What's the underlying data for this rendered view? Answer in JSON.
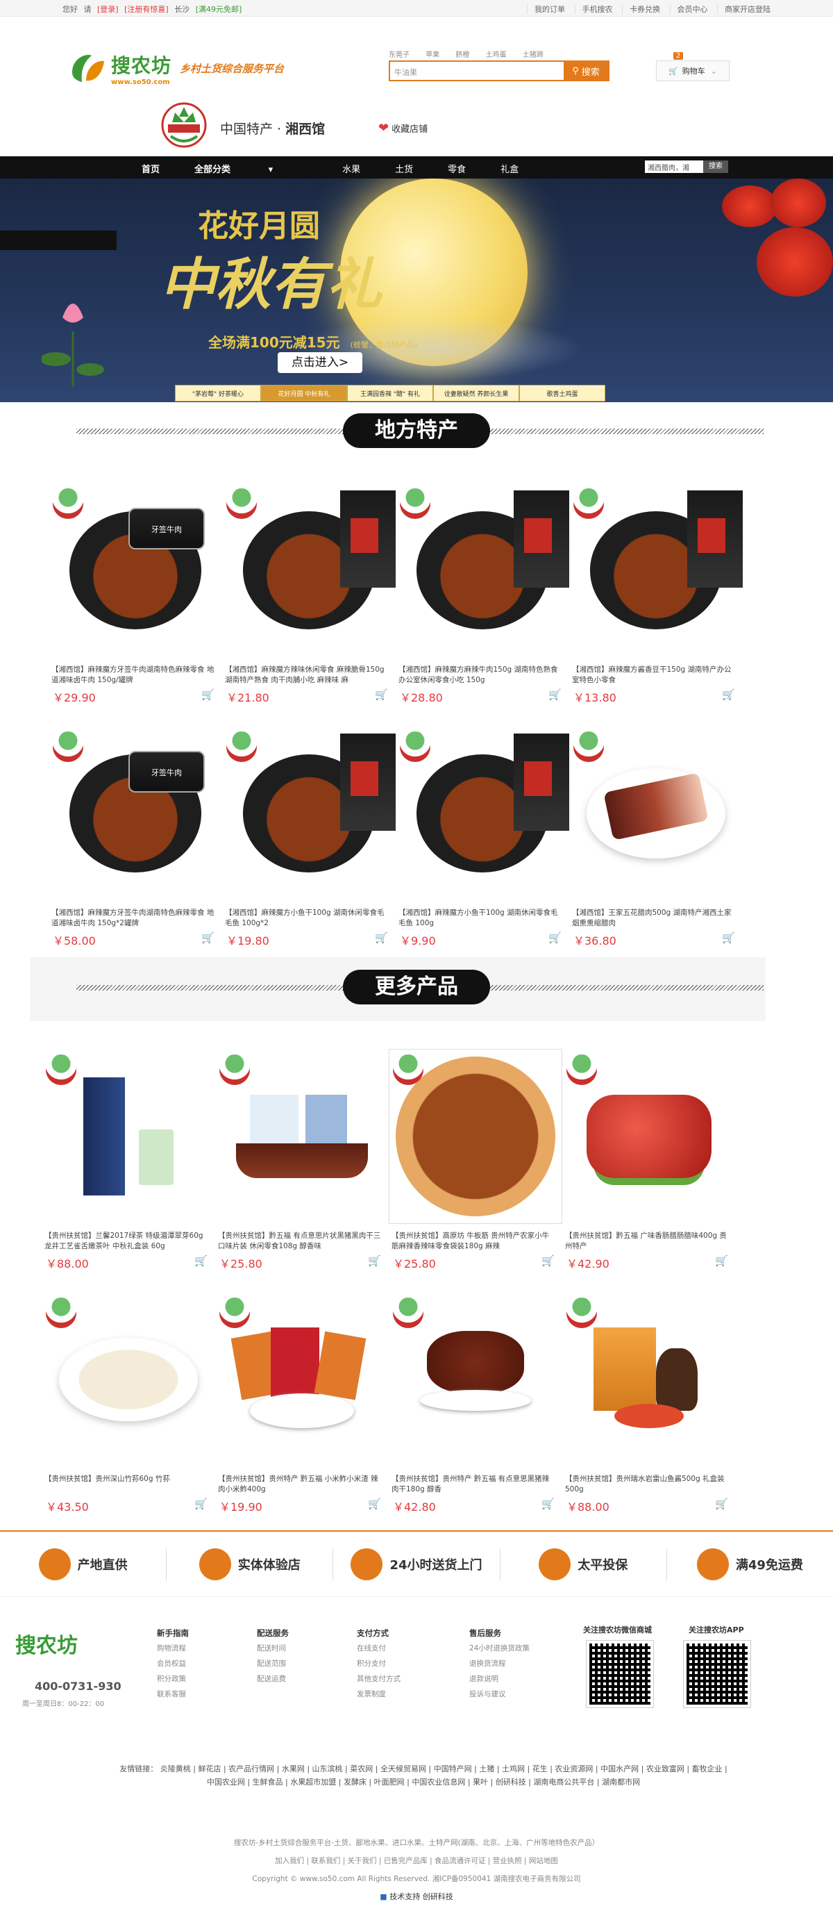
{
  "topbar": {
    "greeting": "您好",
    "login": "请",
    "login_link": "[登录]",
    "register": "[注册有惊喜]",
    "city": "长沙",
    "free_ship": "[满49元免邮]",
    "right_links": [
      "我的订单",
      "手机搜农",
      "卡券兑换",
      "会员中心",
      "商家开店登陆"
    ]
  },
  "header": {
    "logo_cn": "搜农坊",
    "logo_en": "www.so50.com",
    "slogan": "乡村土货综合服务平台",
    "hot_words": [
      "东莞子",
      "苹果",
      "脐橙",
      "土鸡蛋",
      "土猪蹄"
    ],
    "search_placeholder": "牛油果",
    "search_button": "搜索",
    "cart_label": "购物车",
    "cart_count": "2"
  },
  "shop": {
    "name_prefix": "中国特产 ·",
    "name": "湘西馆",
    "favorite": "收藏店铺"
  },
  "nav": {
    "items": [
      "首页",
      "全部分类",
      "水果",
      "土货",
      "零食",
      "礼盒"
    ],
    "search_value": "湘西腊肉，湘",
    "search_button": "搜索"
  },
  "banner": {
    "title1": "花好月圆",
    "title2": "中秋有礼",
    "promo": "全场满100元减15元",
    "promo_note": "(螃蟹、数月特产品)",
    "enter_button": "点击进入>",
    "tabs": [
      "\"茅岩莓\" 好茶暖心",
      "花好月圆 中秋有礼",
      "王满园香辣 \"醋\" 有礼",
      "诠妻散疑然 养颜长生果",
      "歌善土鸡蛋"
    ]
  },
  "sections": {
    "local": "地方特产",
    "more": "更多产品"
  },
  "local_products": [
    {
      "desc": "【湘西馆】麻辣魔方牙签牛肉湖南特色麻辣零食 地道湘味卤牛肉 150g/罐牌",
      "price": "￥29.90"
    },
    {
      "desc": "【湘西馆】麻辣魔方辣味休闲零食 麻辣脆骨150g 湖南特产熟食 肉干肉脯小吃 麻辣味 麻",
      "price": "￥21.80"
    },
    {
      "desc": "【湘西馆】麻辣魔方麻辣牛肉150g 湖南特色熟食 办公室休闲零食小吃 150g",
      "price": "￥28.80"
    },
    {
      "desc": "【湘西馆】麻辣魔方酱香豆干150g 湖南特产办公室特色小零食",
      "price": "￥13.80"
    },
    {
      "desc": "【湘西馆】麻辣魔方牙签牛肉湖南特色麻辣零食 地道湘味卤牛肉 150g*2罐牌",
      "price": "￥58.00"
    },
    {
      "desc": "【湘西馆】麻辣魔方小鱼干100g 湖南休闲零食毛毛鱼 100g*2",
      "price": "￥19.80"
    },
    {
      "desc": "【湘西馆】麻辣魔方小鱼干100g 湖南休闲零食毛毛鱼 100g",
      "price": "￥9.90"
    },
    {
      "desc": "【湘西馆】王家五花腊肉500g 湖南特产湘西土家烟熏熏缩腊肉",
      "price": "￥36.80"
    }
  ],
  "more_products": [
    {
      "desc": "【贵州扶贫馆】兰馨2017绿茶 特级湄潭翠芽60g 龙井工艺雀舌嫩茶叶 中秋礼盒装 60g",
      "price": "￥88.00"
    },
    {
      "desc": "【贵州扶贫馆】黔五福 有点意思片状黑猪黑肉干三口味片装 休闲零食108g 醇香味",
      "price": "￥25.80"
    },
    {
      "desc": "【贵州扶贫馆】高原坊 牛板筋 贵州特产农家小牛筋麻辣香辣味零食袋装180g 麻辣",
      "price": "￥25.80"
    },
    {
      "desc": "【贵州扶贫馆】黔五福 广味香肠腊肠腊味400g 贵州特产",
      "price": "￥42.90"
    },
    {
      "desc": "【贵州扶贫馆】贵州深山竹荪60g 竹荪",
      "price": "￥43.50"
    },
    {
      "desc": "【贵州扶贫馆】贵州特产 黔五福 小米鲊小米渣 辣肉小米鲊400g",
      "price": "￥19.90"
    },
    {
      "desc": "【贵州扶贫馆】贵州特产 黔五福 有点意思黑猪辣肉干180g 醇香",
      "price": "￥42.80"
    },
    {
      "desc": "【贵州扶贫馆】贵州瑞水岩雷山鱼酱500g 礼盒装500g",
      "price": "￥88.00"
    }
  ],
  "features": [
    "产地直供",
    "实体体验店",
    "24小时送货上门",
    "太平投保",
    "满49免运费"
  ],
  "footer": {
    "logo": "搜农坊",
    "phone": "400-0731-930",
    "hours": "周一至周日8：00-22：00",
    "cols": [
      {
        "title": "新手指南",
        "items": [
          "购物流程",
          "会员权益",
          "积分政策",
          "联系客服"
        ]
      },
      {
        "title": "配送服务",
        "items": [
          "配送时间",
          "配送范围",
          "配送运费"
        ]
      },
      {
        "title": "支付方式",
        "items": [
          "在线支付",
          "积分支付",
          "其他支付方式",
          "发票制度"
        ]
      },
      {
        "title": "售后服务",
        "items": [
          "24小时退换货政策",
          "退换货流程",
          "退款说明",
          "投诉与建议"
        ]
      }
    ],
    "qr1_label": "关注搜农坊微信商城",
    "qr2_label": "关注搜农坊APP"
  },
  "friend_links": "友情链接： 炎陵黄桃 | 鲜花店 | 农产品行情网 | 水果网 | 山东滨桃 | 菜农网 | 全天候贸易网 | 中国特产网 | 土猪 | 土鸡网 | 花生 | 农业资源网 | 中国水产网 | 农业致富网 | 畜牧企业 | 中国农业网 | 生鲜食品 | 水果超市加盟 | 发酵床 | 叶面肥网 | 中国农业信息网 | 果叶 | 创研科技 | 湖南电商公共平台 | 湖南都市网",
  "bottom": {
    "line1": "搜农坊-乡村土货综合服务平台-土货、鄙地水果、进口水果、土特产网(湖南、北京、上海、广州等地特色农产品）",
    "line2": "加入我们 | 联系我们 | 关于我们 | 已售完产品库 | 食品流通许可证 | 营业执照 | 网站地图",
    "line3": "Copyright © www.so50.com All Rights Reserved. 湘ICP备0950041 湖南搜农电子商务有限公司",
    "tech": "技术支持 创研科技"
  }
}
